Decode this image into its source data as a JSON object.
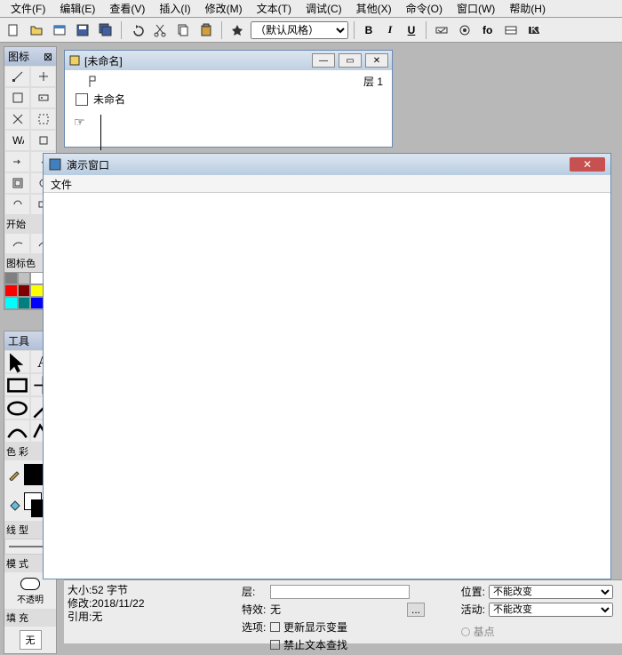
{
  "menu": {
    "file": "文件(F)",
    "edit": "编辑(E)",
    "view": "查看(V)",
    "insert": "插入(I)",
    "modify": "修改(M)",
    "text": "文本(T)",
    "debug": "调试(C)",
    "other": "其他(X)",
    "command": "命令(O)",
    "window": "窗口(W)",
    "help": "帮助(H)"
  },
  "toolbar": {
    "style_select": "（默认风格）",
    "bold": "B",
    "italic": "I",
    "underline": "U"
  },
  "panels": {
    "icon_title": "图标",
    "start_label": "开始",
    "icon_color_label": "图标色",
    "tool_title": "工具",
    "color_label": "色 彩",
    "line_label": "线 型",
    "mode_label": "模 式",
    "opacity_label": "不透明",
    "fill_label": "填 充",
    "fill_none": "无"
  },
  "colors": {
    "row1": [
      "#808080",
      "#c0c0c0",
      "#ffffff",
      "#000000"
    ],
    "row2": [
      "#ff0000",
      "#800000",
      "#ffff00",
      "#808000"
    ],
    "row3": [
      "#00ffff",
      "#008080",
      "#0000ff",
      "#00ff00"
    ]
  },
  "doc": {
    "title": "[未命名]",
    "layer": "层 1",
    "item": "未命名"
  },
  "demo": {
    "title": "演示窗口",
    "menu_file": "文件"
  },
  "props": {
    "size": "大小:52 字节",
    "modified": "修改:2018/11/22",
    "ref": "引用:无",
    "layer_lbl": "层:",
    "effect_lbl": "特效:",
    "effect_val": "无",
    "options_lbl": "选项:",
    "opt1": "更新显示变量",
    "opt2": "禁止文本查找",
    "position_lbl": "位置:",
    "position_val": "不能改变",
    "activity_lbl": "活动:",
    "activity_val": "不能改变",
    "base_lbl": "基点"
  }
}
